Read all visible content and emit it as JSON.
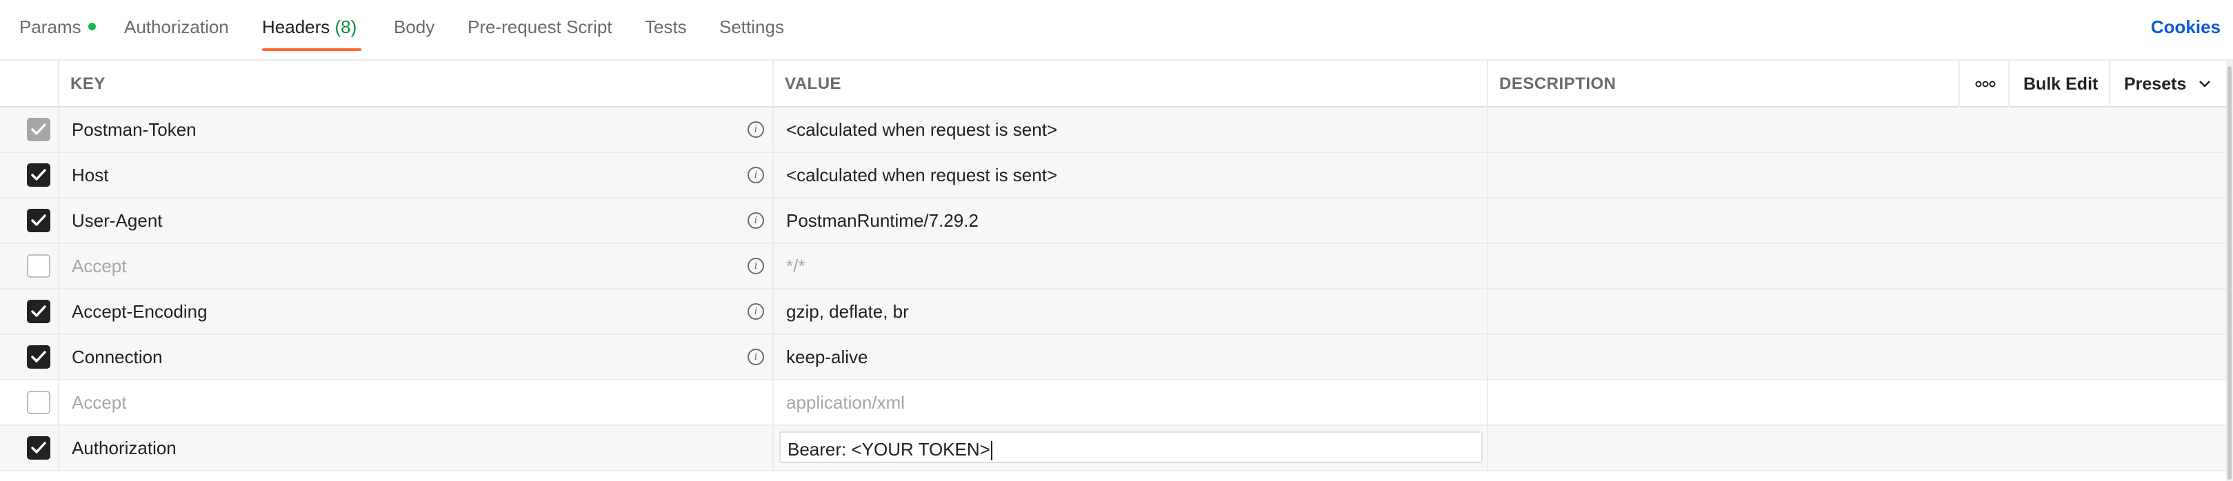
{
  "tabs": [
    {
      "label": "Params",
      "has_dot": true
    },
    {
      "label": "Authorization"
    },
    {
      "label": "Headers",
      "count": "(8)",
      "active": true
    },
    {
      "label": "Body"
    },
    {
      "label": "Pre-request Script"
    },
    {
      "label": "Tests"
    },
    {
      "label": "Settings"
    }
  ],
  "cookies_label": "Cookies",
  "table": {
    "headers": {
      "key": "KEY",
      "value": "VALUE",
      "description": "DESCRIPTION"
    },
    "actions": {
      "more_icon": "more-horizontal-icon",
      "bulk_edit": "Bulk Edit",
      "presets": "Presets"
    },
    "rows": [
      {
        "checked": "locked",
        "key": "Postman-Token",
        "value": "<calculated when request is sent>",
        "info": true
      },
      {
        "checked": "on",
        "key": "Host",
        "value": "<calculated when request is sent>",
        "info": true
      },
      {
        "checked": "on",
        "key": "User-Agent",
        "value": "PostmanRuntime/7.29.2",
        "info": true
      },
      {
        "checked": "off",
        "key": "Accept",
        "value": "*/*",
        "info": true
      },
      {
        "checked": "on",
        "key": "Accept-Encoding",
        "value": "gzip, deflate, br",
        "info": true
      },
      {
        "checked": "on",
        "key": "Connection",
        "value": "keep-alive",
        "info": true
      },
      {
        "checked": "off",
        "key": "Accept",
        "value": "application/xml",
        "info": false
      },
      {
        "checked": "on",
        "key": "Authorization",
        "value": "Bearer: <YOUR TOKEN>",
        "info": false,
        "editing": true
      }
    ]
  },
  "colors": {
    "accent": "#ff6c37",
    "link": "#0b5bd6",
    "status_dot": "#0cbb52"
  }
}
